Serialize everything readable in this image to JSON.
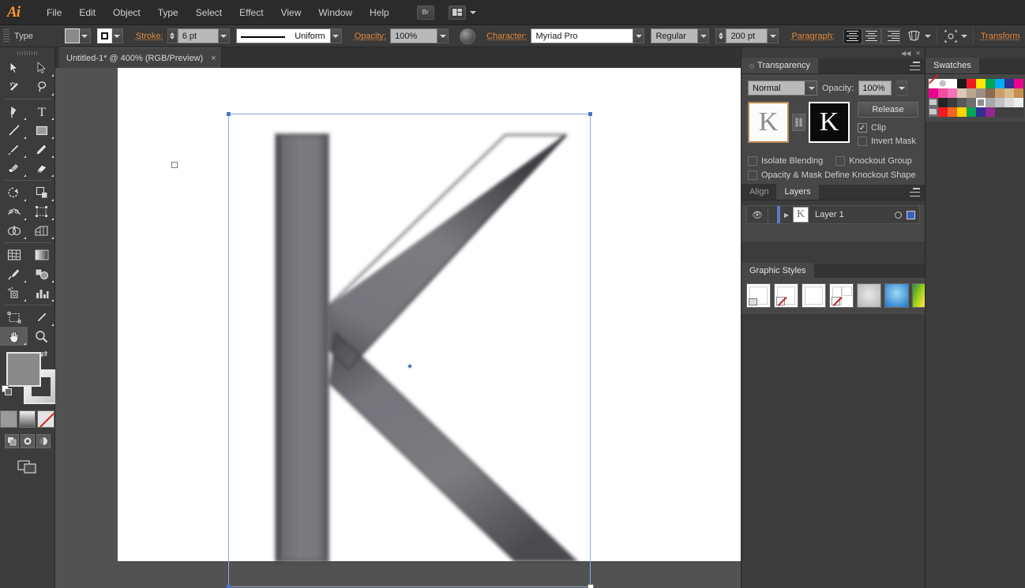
{
  "app": {
    "logo": "Ai",
    "menus": [
      "File",
      "Edit",
      "Object",
      "Type",
      "Select",
      "Effect",
      "View",
      "Window",
      "Help"
    ],
    "bridge_button": "Br",
    "arrange_icon": "arrange-documents-icon"
  },
  "control_bar": {
    "tool_label": "Type",
    "fill_label": "fill-swatch",
    "stroke_label_icon": "stroke-swatch",
    "stroke_label": "Stroke:",
    "stroke_weight": "6 pt",
    "stroke_profile": "Uniform",
    "opacity_label": "Opacity:",
    "opacity_value": "100%",
    "character_label": "Character:",
    "font_family": "Myriad Pro",
    "font_style": "Regular",
    "font_size": "200 pt",
    "paragraph_label": "Paragraph:",
    "align_options": [
      "align-left",
      "align-center",
      "align-right"
    ],
    "align_active": "align-left",
    "transform_label": "Transform"
  },
  "toolbar": {
    "tools": [
      {
        "name": "selection-tool",
        "glyph": "selection"
      },
      {
        "name": "direct-selection-tool",
        "glyph": "direct"
      },
      {
        "name": "magic-wand-tool",
        "glyph": "wand"
      },
      {
        "name": "lasso-tool",
        "glyph": "lasso"
      },
      {
        "name": "pen-tool",
        "glyph": "pen"
      },
      {
        "name": "type-tool",
        "glyph": "type"
      },
      {
        "name": "line-segment-tool",
        "glyph": "line"
      },
      {
        "name": "rectangle-tool",
        "glyph": "rect"
      },
      {
        "name": "paintbrush-tool",
        "glyph": "brush"
      },
      {
        "name": "pencil-tool",
        "glyph": "pencil"
      },
      {
        "name": "blob-brush-tool",
        "glyph": "blob"
      },
      {
        "name": "eraser-tool",
        "glyph": "eraser"
      },
      {
        "name": "rotate-tool",
        "glyph": "rotate"
      },
      {
        "name": "scale-tool",
        "glyph": "scale"
      },
      {
        "name": "width-tool",
        "glyph": "width"
      },
      {
        "name": "free-transform-tool",
        "glyph": "freetransform"
      },
      {
        "name": "shape-builder-tool",
        "glyph": "shapebuilder"
      },
      {
        "name": "perspective-grid-tool",
        "glyph": "perspective"
      },
      {
        "name": "mesh-tool",
        "glyph": "mesh"
      },
      {
        "name": "gradient-tool",
        "glyph": "gradient"
      },
      {
        "name": "eyedropper-tool",
        "glyph": "eyedropper"
      },
      {
        "name": "blend-tool",
        "glyph": "blend"
      },
      {
        "name": "symbol-sprayer-tool",
        "glyph": "symbolsprayer"
      },
      {
        "name": "column-graph-tool",
        "glyph": "graph"
      },
      {
        "name": "artboard-tool",
        "glyph": "artboard"
      },
      {
        "name": "slice-tool",
        "glyph": "slice"
      },
      {
        "name": "hand-tool",
        "glyph": "hand",
        "selected": true
      },
      {
        "name": "zoom-tool",
        "glyph": "zoom"
      }
    ],
    "fill_color": "#8a8a8a",
    "stroke_color": "#ffffff",
    "color_modes": [
      "color-mode",
      "gradient-mode",
      "none-mode"
    ],
    "draw_modes": [
      "draw-normal",
      "draw-behind",
      "draw-inside"
    ],
    "screen_mode": "change-screen-mode"
  },
  "document": {
    "tab_title": "Untitled-1* @ 400% (RGB/Preview)",
    "close_glyph": "×",
    "artwork_letter": "K"
  },
  "transparency_panel": {
    "title": "Transparency",
    "blend_mode": "Normal",
    "opacity_label": "Opacity:",
    "opacity_value": "100%",
    "artwork_thumb": "K",
    "mask_thumb": "K",
    "release_button": "Release",
    "clip_label": "Clip",
    "clip_checked": true,
    "invert_mask_label": "Invert Mask",
    "invert_mask_checked": false,
    "isolate_blending_label": "Isolate Blending",
    "knockout_group_label": "Knockout Group",
    "knockout_shape_label": "Opacity & Mask Define Knockout Shape"
  },
  "layers_panel": {
    "tabs": [
      "Align",
      "Layers"
    ],
    "active_tab": "Layers",
    "rows": [
      {
        "name": "Layer 1",
        "thumb": "K",
        "visible": true
      }
    ]
  },
  "graphic_styles_panel": {
    "title": "Graphic Styles",
    "styles": [
      {
        "name": "default-style",
        "kind": "default"
      },
      {
        "name": "none-style",
        "kind": "none"
      },
      {
        "name": "white-style",
        "kind": "plain"
      },
      {
        "name": "none-split-style",
        "kind": "none-split"
      },
      {
        "name": "soft-gray-style",
        "kind": "gray-blur",
        "color": "#d8d8d8"
      },
      {
        "name": "blue-glow-style",
        "kind": "gradient",
        "color": "#3aa8e8"
      },
      {
        "name": "green-yellow-style",
        "kind": "texture",
        "color": "#86c41f"
      },
      {
        "name": "teal-texture-style",
        "kind": "texture",
        "color": "#2a7f9e"
      },
      {
        "name": "dark-gray-style",
        "kind": "flat",
        "color": "#5c5c5c"
      },
      {
        "name": "medium-gray-style",
        "kind": "flat",
        "color": "#8f8f8f"
      }
    ]
  },
  "swatches_panel": {
    "title": "Swatches",
    "selected_index": 25,
    "colors": [
      "none",
      "registration",
      "#ffffff",
      "#1b1b1b",
      "#ed1c24",
      "#ffe800",
      "#00a651",
      "#00aeef",
      "#2e3192",
      "#ec008c",
      "#ec008c",
      "#f04fa0",
      "#f472b6",
      "#d8c8b4",
      "#b9a48e",
      "#9c8e84",
      "#8a6a52",
      "#c9a06a",
      "#d8b98a",
      "#c58f4e",
      "group",
      "#242424",
      "#3b3b3b",
      "#585858",
      "#6e6e6e",
      "#8f8f8f",
      "#a8a8a8",
      "#c2c2c2",
      "#dcdcdc",
      "#f0f0f0",
      "group",
      "#ed1c24",
      "#f26522",
      "#ffd400",
      "#00a651",
      "#2e3192",
      "#92278f",
      "#3f3f3f",
      "#3f3f3f",
      "#3f3f3f"
    ]
  }
}
